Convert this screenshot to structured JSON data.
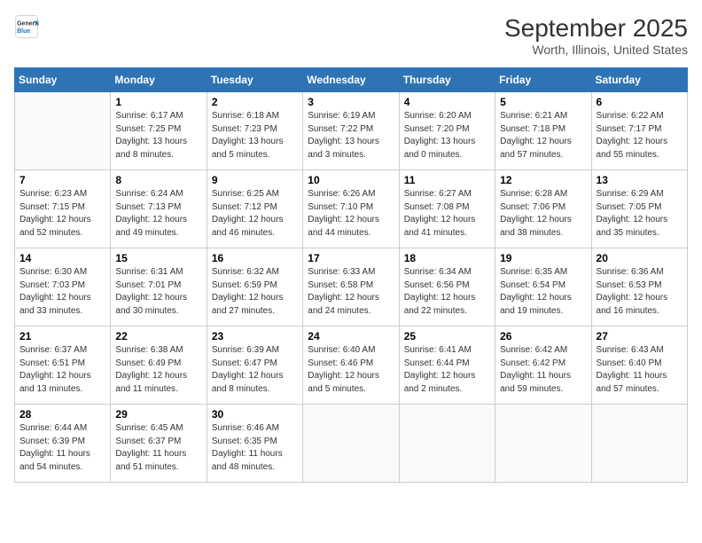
{
  "header": {
    "logo_general": "General",
    "logo_blue": "Blue",
    "month_year": "September 2025",
    "location": "Worth, Illinois, United States"
  },
  "columns": [
    "Sunday",
    "Monday",
    "Tuesday",
    "Wednesday",
    "Thursday",
    "Friday",
    "Saturday"
  ],
  "weeks": [
    [
      {
        "num": "",
        "info": ""
      },
      {
        "num": "1",
        "info": "Sunrise: 6:17 AM\nSunset: 7:25 PM\nDaylight: 13 hours\nand 8 minutes."
      },
      {
        "num": "2",
        "info": "Sunrise: 6:18 AM\nSunset: 7:23 PM\nDaylight: 13 hours\nand 5 minutes."
      },
      {
        "num": "3",
        "info": "Sunrise: 6:19 AM\nSunset: 7:22 PM\nDaylight: 13 hours\nand 3 minutes."
      },
      {
        "num": "4",
        "info": "Sunrise: 6:20 AM\nSunset: 7:20 PM\nDaylight: 13 hours\nand 0 minutes."
      },
      {
        "num": "5",
        "info": "Sunrise: 6:21 AM\nSunset: 7:18 PM\nDaylight: 12 hours\nand 57 minutes."
      },
      {
        "num": "6",
        "info": "Sunrise: 6:22 AM\nSunset: 7:17 PM\nDaylight: 12 hours\nand 55 minutes."
      }
    ],
    [
      {
        "num": "7",
        "info": "Sunrise: 6:23 AM\nSunset: 7:15 PM\nDaylight: 12 hours\nand 52 minutes."
      },
      {
        "num": "8",
        "info": "Sunrise: 6:24 AM\nSunset: 7:13 PM\nDaylight: 12 hours\nand 49 minutes."
      },
      {
        "num": "9",
        "info": "Sunrise: 6:25 AM\nSunset: 7:12 PM\nDaylight: 12 hours\nand 46 minutes."
      },
      {
        "num": "10",
        "info": "Sunrise: 6:26 AM\nSunset: 7:10 PM\nDaylight: 12 hours\nand 44 minutes."
      },
      {
        "num": "11",
        "info": "Sunrise: 6:27 AM\nSunset: 7:08 PM\nDaylight: 12 hours\nand 41 minutes."
      },
      {
        "num": "12",
        "info": "Sunrise: 6:28 AM\nSunset: 7:06 PM\nDaylight: 12 hours\nand 38 minutes."
      },
      {
        "num": "13",
        "info": "Sunrise: 6:29 AM\nSunset: 7:05 PM\nDaylight: 12 hours\nand 35 minutes."
      }
    ],
    [
      {
        "num": "14",
        "info": "Sunrise: 6:30 AM\nSunset: 7:03 PM\nDaylight: 12 hours\nand 33 minutes."
      },
      {
        "num": "15",
        "info": "Sunrise: 6:31 AM\nSunset: 7:01 PM\nDaylight: 12 hours\nand 30 minutes."
      },
      {
        "num": "16",
        "info": "Sunrise: 6:32 AM\nSunset: 6:59 PM\nDaylight: 12 hours\nand 27 minutes."
      },
      {
        "num": "17",
        "info": "Sunrise: 6:33 AM\nSunset: 6:58 PM\nDaylight: 12 hours\nand 24 minutes."
      },
      {
        "num": "18",
        "info": "Sunrise: 6:34 AM\nSunset: 6:56 PM\nDaylight: 12 hours\nand 22 minutes."
      },
      {
        "num": "19",
        "info": "Sunrise: 6:35 AM\nSunset: 6:54 PM\nDaylight: 12 hours\nand 19 minutes."
      },
      {
        "num": "20",
        "info": "Sunrise: 6:36 AM\nSunset: 6:53 PM\nDaylight: 12 hours\nand 16 minutes."
      }
    ],
    [
      {
        "num": "21",
        "info": "Sunrise: 6:37 AM\nSunset: 6:51 PM\nDaylight: 12 hours\nand 13 minutes."
      },
      {
        "num": "22",
        "info": "Sunrise: 6:38 AM\nSunset: 6:49 PM\nDaylight: 12 hours\nand 11 minutes."
      },
      {
        "num": "23",
        "info": "Sunrise: 6:39 AM\nSunset: 6:47 PM\nDaylight: 12 hours\nand 8 minutes."
      },
      {
        "num": "24",
        "info": "Sunrise: 6:40 AM\nSunset: 6:46 PM\nDaylight: 12 hours\nand 5 minutes."
      },
      {
        "num": "25",
        "info": "Sunrise: 6:41 AM\nSunset: 6:44 PM\nDaylight: 12 hours\nand 2 minutes."
      },
      {
        "num": "26",
        "info": "Sunrise: 6:42 AM\nSunset: 6:42 PM\nDaylight: 11 hours\nand 59 minutes."
      },
      {
        "num": "27",
        "info": "Sunrise: 6:43 AM\nSunset: 6:40 PM\nDaylight: 11 hours\nand 57 minutes."
      }
    ],
    [
      {
        "num": "28",
        "info": "Sunrise: 6:44 AM\nSunset: 6:39 PM\nDaylight: 11 hours\nand 54 minutes."
      },
      {
        "num": "29",
        "info": "Sunrise: 6:45 AM\nSunset: 6:37 PM\nDaylight: 11 hours\nand 51 minutes."
      },
      {
        "num": "30",
        "info": "Sunrise: 6:46 AM\nSunset: 6:35 PM\nDaylight: 11 hours\nand 48 minutes."
      },
      {
        "num": "",
        "info": ""
      },
      {
        "num": "",
        "info": ""
      },
      {
        "num": "",
        "info": ""
      },
      {
        "num": "",
        "info": ""
      }
    ]
  ]
}
